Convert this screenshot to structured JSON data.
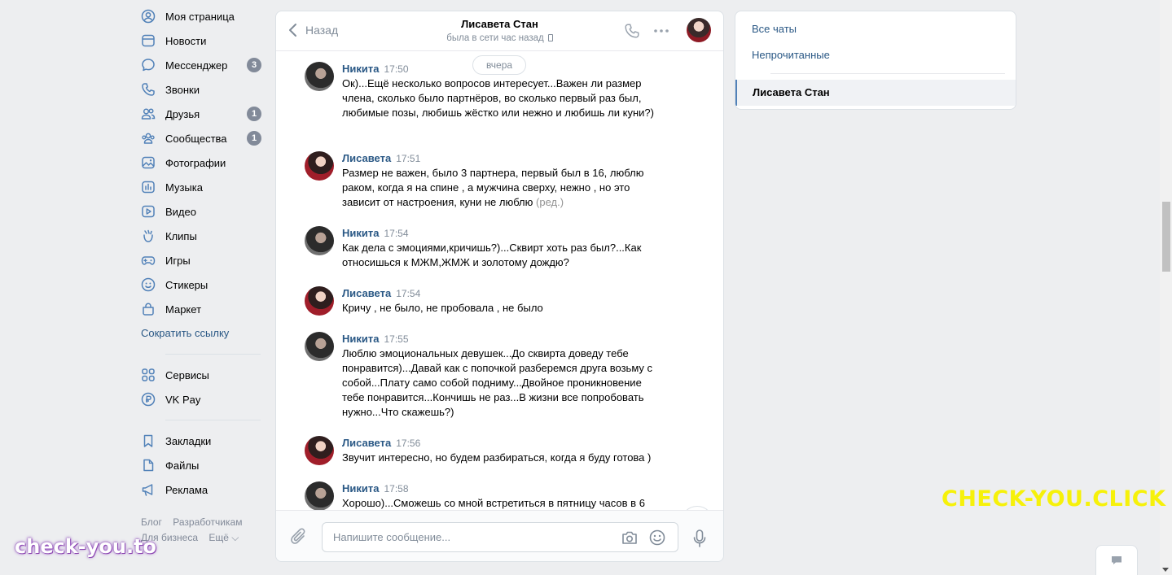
{
  "left_nav": {
    "items": [
      {
        "label": "Моя страница",
        "icon": "user-circle-icon"
      },
      {
        "label": "Новости",
        "icon": "news-icon"
      },
      {
        "label": "Мессенджер",
        "icon": "message-icon",
        "badge": "3"
      },
      {
        "label": "Звонки",
        "icon": "phone-icon"
      },
      {
        "label": "Друзья",
        "icon": "friends-icon",
        "badge": "1"
      },
      {
        "label": "Сообщества",
        "icon": "communities-icon",
        "badge": "1"
      },
      {
        "label": "Фотографии",
        "icon": "photo-icon"
      },
      {
        "label": "Музыка",
        "icon": "music-icon"
      },
      {
        "label": "Видео",
        "icon": "video-icon"
      },
      {
        "label": "Клипы",
        "icon": "clips-icon"
      },
      {
        "label": "Игры",
        "icon": "gamepad-icon"
      },
      {
        "label": "Стикеры",
        "icon": "sticker-icon"
      },
      {
        "label": "Маркет",
        "icon": "market-icon"
      }
    ],
    "shorten_link": "Сократить ссылку",
    "services": [
      {
        "label": "Сервисы",
        "icon": "services-icon"
      },
      {
        "label": "VK Pay",
        "icon": "vkpay-icon"
      }
    ],
    "extras": [
      {
        "label": "Закладки",
        "icon": "bookmark-icon"
      },
      {
        "label": "Файлы",
        "icon": "file-icon"
      },
      {
        "label": "Реклама",
        "icon": "ads-icon"
      }
    ],
    "footer": {
      "blog": "Блог",
      "developers": "Разработчикам",
      "business": "Для бизнеса",
      "more": "Ещё ⌵"
    }
  },
  "chat": {
    "back_label": "Назад",
    "name": "Лисавета Стан",
    "status": "была в сети час назад",
    "day_label": "вчера",
    "messages": [
      {
        "author": "Никита",
        "time": "17:50",
        "side": "nikita",
        "text": "Ок)...Ещё несколько вопросов интересует...Важен ли размер члена, сколько было партнёров, во сколько первый раз был, любимые позы, любишь жёстко или нежно и любишь ли куни?)"
      },
      {
        "author": "Лисавета",
        "time": "17:51",
        "side": "lisa",
        "text": "Размер не важен, было 3 партнера, первый был в 16, люблю раком, когда я на спине , а мужчина сверху, нежно , но это зависит от настроения, куни не люблю",
        "edited": "(ред.)"
      },
      {
        "author": "Никита",
        "time": "17:54",
        "side": "nikita",
        "text": "Как дела с эмоциями,кричишь?)...Сквирт хоть раз был?...Как относишься к МЖМ,ЖМЖ и золотому дождю?"
      },
      {
        "author": "Лисавета",
        "time": "17:54",
        "side": "lisa",
        "text": "Кричу , не было, не пробовала , не было"
      },
      {
        "author": "Никита",
        "time": "17:55",
        "side": "nikita",
        "text": "Люблю эмоциональных девушек...До сквирта доведу тебе понравится)...Давай как с попочкой разберемся друга возьму с собой...Плату само собой подниму...Двойное проникновение тебе понравится...Кончишь не раз...В жизни все попробовать нужно...Что скажешь?)"
      },
      {
        "author": "Лисавета",
        "time": "17:56",
        "side": "lisa",
        "text": "Звучит интересно, но будем разбираться, когда я буду готова )"
      },
      {
        "author": "Никита",
        "time": "17:58",
        "side": "nikita",
        "text": "Хорошо)...Сможешь со мной встретиться в пятницу часов в 6"
      }
    ],
    "composer_placeholder": "Напишите сообщение..."
  },
  "right_panel": {
    "all_chats": "Все чаты",
    "unread": "Непрочитанные",
    "active_chat": "Лисавета Стан"
  },
  "watermarks": {
    "yellow": "CHECK-YOU.CLICK",
    "purple": "check-you.to"
  },
  "colors": {
    "link": "#2a5885",
    "badge": "#828a99",
    "muted": "#818c99",
    "icon": "#5181b8",
    "background": "#edeef0"
  }
}
